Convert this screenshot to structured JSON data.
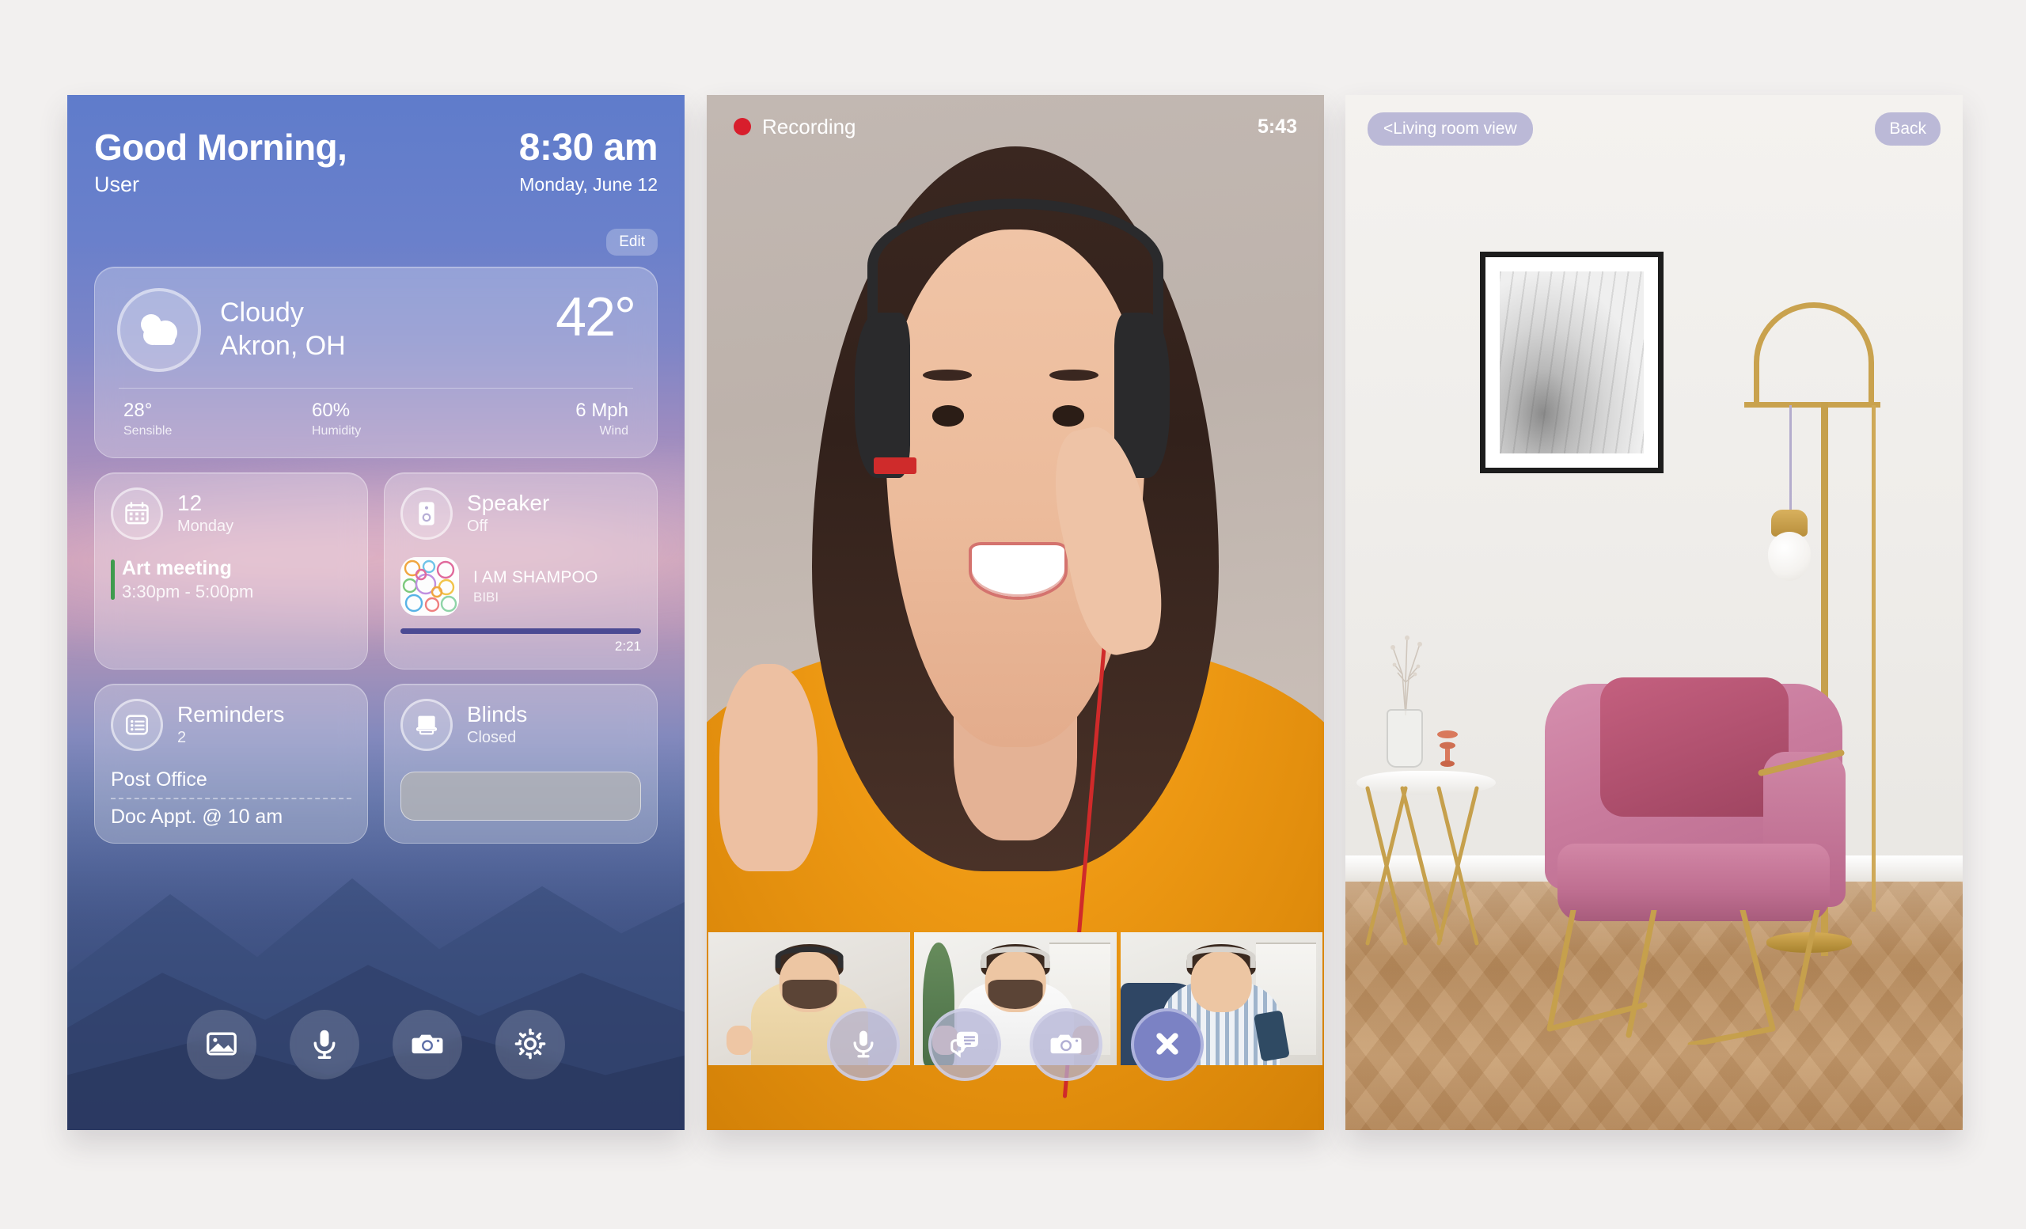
{
  "home": {
    "greeting": "Good Morning,",
    "user": "User",
    "time": "8:30 am",
    "date": "Monday, June 12",
    "edit_label": "Edit",
    "weather": {
      "icon": "cloudy-icon",
      "condition": "Cloudy",
      "location": "Akron, OH",
      "temperature": "42°",
      "stats": [
        {
          "value": "28°",
          "label": "Sensible"
        },
        {
          "value": "60%",
          "label": "Humidity"
        },
        {
          "value": "6 Mph",
          "label": "Wind"
        }
      ]
    },
    "calendar": {
      "icon": "calendar-icon",
      "day_number": "12",
      "day_name": "Monday",
      "event_title": "Art meeting",
      "event_time": "3:30pm - 5:00pm",
      "accent_color": "#3f9b4e"
    },
    "speaker": {
      "icon": "speaker-icon",
      "title": "Speaker",
      "status": "Off",
      "track_title": "I AM SHAMPOO",
      "track_artist": "BIBI",
      "track_time": "2:21",
      "progress_color": "#4b4a93"
    },
    "reminders": {
      "icon": "reminders-icon",
      "title": "Reminders",
      "count": "2",
      "items": [
        "Post Office",
        "Doc Appt. @ 10 am"
      ]
    },
    "blinds": {
      "icon": "blinds-icon",
      "title": "Blinds",
      "status": "Closed"
    },
    "dock": [
      {
        "icon": "photos-icon",
        "label": "Photos"
      },
      {
        "icon": "microphone-icon",
        "label": "Voice"
      },
      {
        "icon": "camera-icon",
        "label": "Camera"
      },
      {
        "icon": "gear-icon",
        "label": "Settings"
      }
    ]
  },
  "call": {
    "recording_label": "Recording",
    "recording_dot_color": "#d81e2c",
    "timer": "5:43",
    "participants": [
      "participant-1",
      "participant-2",
      "participant-3"
    ],
    "controls": [
      {
        "icon": "microphone-icon",
        "label": "Mute",
        "style": "normal"
      },
      {
        "icon": "chat-icon",
        "label": "Chat",
        "style": "normal"
      },
      {
        "icon": "camera-icon",
        "label": "Snapshot",
        "style": "normal"
      },
      {
        "icon": "close-icon",
        "label": "End call",
        "style": "end"
      }
    ]
  },
  "room": {
    "view_label": "<Living room view",
    "back_label": "Back"
  }
}
